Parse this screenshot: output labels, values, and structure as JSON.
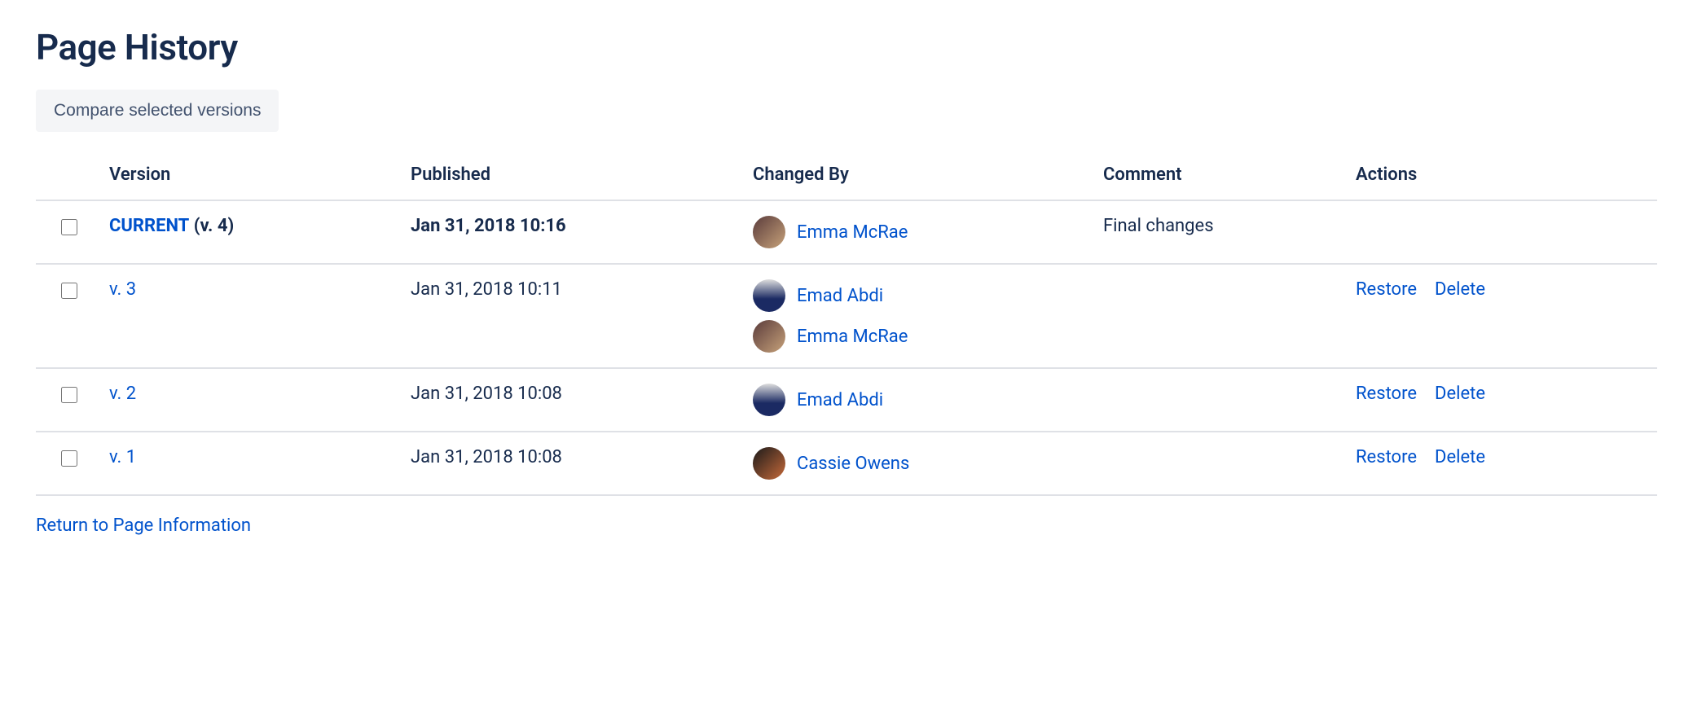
{
  "page": {
    "title": "Page History",
    "compare_button": "Compare selected versions",
    "return_link": "Return to Page Information"
  },
  "table": {
    "headers": {
      "version": "Version",
      "published": "Published",
      "changed_by": "Changed By",
      "comment": "Comment",
      "actions": "Actions"
    },
    "rows": [
      {
        "current": true,
        "version_label": "CURRENT",
        "version_suffix": "(v. 4)",
        "published": "Jan 31, 2018 10:16",
        "users": [
          {
            "name": "Emma McRae",
            "avatar_bg": "linear-gradient(135deg,#5a3b3b 0%,#c7a27a 100%)"
          }
        ],
        "comment": "Final changes",
        "actions": []
      },
      {
        "current": false,
        "version_label": "v. 3",
        "version_suffix": "",
        "published": "Jan 31, 2018 10:11",
        "users": [
          {
            "name": "Emad Abdi",
            "avatar_bg": "linear-gradient(180deg,#dedede 0%,#1b2a63 60%)"
          },
          {
            "name": "Emma McRae",
            "avatar_bg": "linear-gradient(135deg,#5a3b3b 0%,#c7a27a 100%)"
          }
        ],
        "comment": "",
        "actions": [
          "Restore",
          "Delete"
        ]
      },
      {
        "current": false,
        "version_label": "v. 2",
        "version_suffix": "",
        "published": "Jan 31, 2018 10:08",
        "users": [
          {
            "name": "Emad Abdi",
            "avatar_bg": "linear-gradient(180deg,#dedede 0%,#1b2a63 60%)"
          }
        ],
        "comment": "",
        "actions": [
          "Restore",
          "Delete"
        ]
      },
      {
        "current": false,
        "version_label": "v. 1",
        "version_suffix": "",
        "published": "Jan 31, 2018 10:08",
        "users": [
          {
            "name": "Cassie Owens",
            "avatar_bg": "linear-gradient(135deg,#1a1a1a 0%,#c76a3a 100%)"
          }
        ],
        "comment": "",
        "actions": [
          "Restore",
          "Delete"
        ]
      }
    ]
  }
}
